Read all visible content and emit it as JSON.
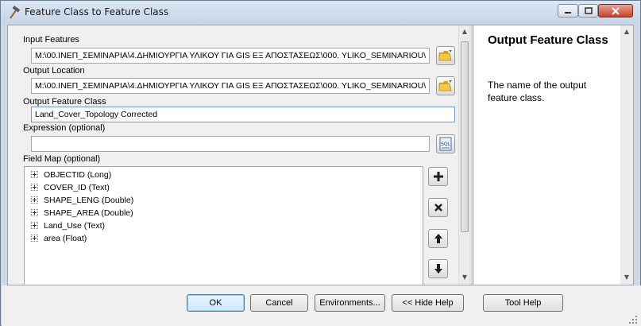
{
  "window": {
    "title": "Feature Class to Feature Class"
  },
  "form": {
    "input_features": {
      "label": "Input Features",
      "value": "M:\\00.ΙΝΕΠ_ΣΕΜΙΝΑΡΙΑ\\4.ΔΗΜΙΟΥΡΓΙΑ ΥΛΙΚΟΥ ΓΙΑ GIS ΕΞ ΑΠΟΣΤΑΣΕΩΣ\\000. YLIKO_SEMINARIOU\\"
    },
    "output_location": {
      "label": "Output Location",
      "value": "M:\\00.ΙΝΕΠ_ΣΕΜΙΝΑΡΙΑ\\4.ΔΗΜΙΟΥΡΓΙΑ ΥΛΙΚΟΥ ΓΙΑ GIS ΕΞ ΑΠΟΣΤΑΣΕΩΣ\\000. YLIKO_SEMINARIOU\\"
    },
    "output_feature_class": {
      "label": "Output Feature Class",
      "value": "Land_Cover_Topology Corrected"
    },
    "expression": {
      "label": "Expression (optional)",
      "value": "",
      "sql_button": "SQL"
    },
    "field_map": {
      "label": "Field Map (optional)",
      "fields": [
        "OBJECTID (Long)",
        "COVER_ID (Text)",
        "SHAPE_LENG (Double)",
        "SHAPE_AREA (Double)",
        "Land_Use (Text)",
        "area (Float)"
      ]
    }
  },
  "help": {
    "title": "Output Feature Class",
    "body": "The name of the output feature class."
  },
  "buttons": {
    "ok": "OK",
    "cancel": "Cancel",
    "environments": "Environments...",
    "hide_help": "<< Hide Help",
    "tool_help": "Tool Help"
  },
  "colors": {
    "accent": "#3c7fb1",
    "close_button": "#c7432b"
  }
}
